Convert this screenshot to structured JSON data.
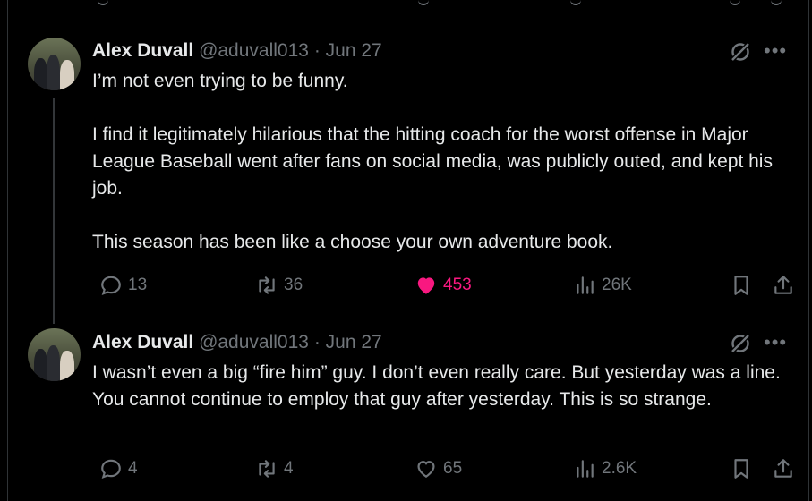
{
  "tweets": [
    {
      "author": "Alex Duvall",
      "handle": "@aduvall013",
      "separator": "·",
      "date": "Jun 27",
      "text": [
        "I’m not even trying to be funny.",
        "I find it legitimately hilarious that the hitting coach for the worst offense in Major League Baseball went after fans on social media, was publicly outed, and kept his job.",
        "This season has been like a choose your own adventure book."
      ],
      "replies": "13",
      "reposts": "36",
      "likes": "453",
      "liked": true,
      "views": "26K"
    },
    {
      "author": "Alex Duvall",
      "handle": "@aduvall013",
      "separator": "·",
      "date": "Jun 27",
      "text": [
        "I wasn’t even a big “fire him” guy. I don’t even really care. But yesterday was a line. You cannot continue to employ that guy after yesterday. This is so strange."
      ],
      "replies": "4",
      "reposts": "4",
      "likes": "65",
      "liked": false,
      "views": "2.6K"
    }
  ],
  "icons": {
    "reply": "reply-icon",
    "repost": "repost-icon",
    "like": "heart-icon",
    "views": "views-icon",
    "bookmark": "bookmark-icon",
    "share": "share-icon",
    "grok": "grok-icon",
    "more": "more-icon"
  },
  "colors": {
    "background": "#000000",
    "text": "#e7e9ea",
    "muted": "#71767b",
    "like": "#f91880",
    "divider": "#2f3336"
  }
}
